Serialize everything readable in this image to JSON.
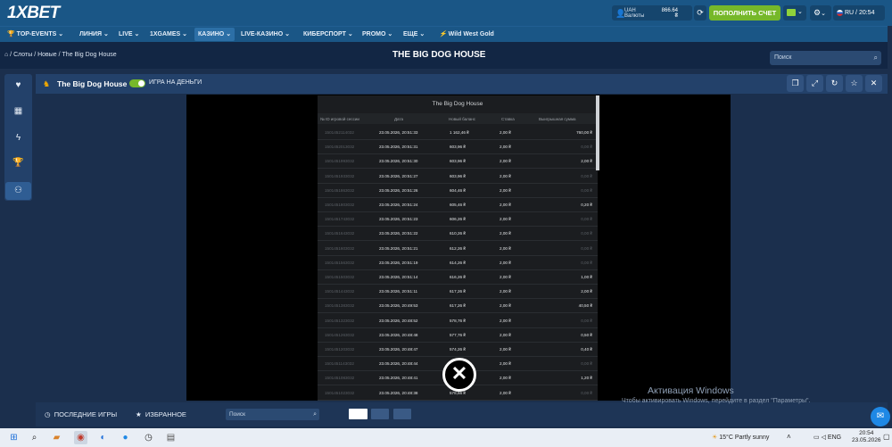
{
  "brand": {
    "logo": "1XBET"
  },
  "account": {
    "currency": "UAH",
    "currency_label": "Валюты",
    "balance": "866.64",
    "balance_sub": "₴"
  },
  "buttons": {
    "deposit": "ПОПОЛНИТЬ СЧЕТ",
    "lang_time": "RU / 20:54"
  },
  "nav": [
    {
      "label": "TOP-EVENTS ⌄"
    },
    {
      "label": "ЛИНИЯ ⌄"
    },
    {
      "label": "LIVE ⌄"
    },
    {
      "label": "1XGAMES ⌄"
    },
    {
      "label": "КАЗИНО ⌄"
    },
    {
      "label": "LIVE-КАЗИНО ⌄"
    },
    {
      "label": "КИБЕРСПОРТ ⌄"
    },
    {
      "label": "PROMO ⌄"
    },
    {
      "label": "ЕЩЕ ⌄"
    },
    {
      "label": "Wild West Gold"
    }
  ],
  "breadcrumb": "Слоты / Новые / The Big Dog House",
  "page_title": "THE BIG DOG HOUSE",
  "search_placeholder": "Поиск",
  "game_header": {
    "title": "The Big Dog House",
    "money_toggle": "ИГРА НА ДЕНЬГИ"
  },
  "history": {
    "title": "The Big Dog House",
    "columns": [
      "№ ID игровой сессии",
      "Дата",
      "Новый баланс",
      "Ставка",
      "Выигрышная сумма"
    ],
    "rows": [
      [
        "1501452114032",
        "23.05.2026, 20:51:33",
        "1 162,46 ₴",
        "2,00 ₴",
        "760,00 ₴"
      ],
      [
        "1501452013032",
        "23.05.2026, 20:51:31",
        "603,96 ₴",
        "2,00 ₴",
        "0,00 ₴"
      ],
      [
        "1501451993032",
        "23.05.2026, 20:51:30",
        "603,96 ₴",
        "2,00 ₴",
        "2,00 ₴"
      ],
      [
        "1501451933032",
        "23.05.2026, 20:51:27",
        "603,96 ₴",
        "2,00 ₴",
        "0,00 ₴"
      ],
      [
        "1501451863032",
        "23.05.2026, 20:51:26",
        "604,46 ₴",
        "2,00 ₴",
        "0,00 ₴"
      ],
      [
        "1501451803032",
        "23.05.2026, 20:51:24",
        "605,46 ₴",
        "2,00 ₴",
        "0,20 ₴"
      ],
      [
        "1501451743032",
        "23.05.2026, 20:51:23",
        "606,26 ₴",
        "2,00 ₴",
        "0,00 ₴"
      ],
      [
        "1501451643032",
        "23.05.2026, 20:51:22",
        "610,26 ₴",
        "2,00 ₴",
        "0,00 ₴"
      ],
      [
        "1501451603032",
        "23.05.2026, 20:51:21",
        "612,26 ₴",
        "2,00 ₴",
        "0,00 ₴"
      ],
      [
        "1501451563032",
        "23.05.2026, 20:51:19",
        "614,26 ₴",
        "2,00 ₴",
        "0,00 ₴"
      ],
      [
        "1501451503032",
        "23.05.2026, 20:51:14",
        "616,26 ₴",
        "2,00 ₴",
        "1,00 ₴"
      ],
      [
        "1501451443032",
        "23.05.2026, 20:51:11",
        "617,26 ₴",
        "2,00 ₴",
        "2,00 ₴"
      ],
      [
        "1501451383032",
        "23.05.2026, 20:49:53",
        "617,26 ₴",
        "2,00 ₴",
        "40,50 ₴"
      ],
      [
        "1501451323032",
        "23.05.2026, 20:48:52",
        "578,76 ₴",
        "2,00 ₴",
        "0,00 ₴"
      ],
      [
        "1501451263032",
        "23.05.2026, 20:48:48",
        "577,76 ₴",
        "2,00 ₴",
        "0,50 ₴"
      ],
      [
        "1501451203032",
        "23.05.2026, 20:48:47",
        "574,26 ₴",
        "2,00 ₴",
        "0,40 ₴"
      ],
      [
        "1501451143032",
        "23.05.2026, 20:48:44",
        "575,86 ₴",
        "2,00 ₴",
        "0,00 ₴"
      ],
      [
        "1501451083032",
        "23.05.2026, 20:48:41",
        "577,86 ₴",
        "2,00 ₴",
        "1,20 ₴"
      ],
      [
        "1501451023032",
        "23.05.2026, 20:48:38",
        "578,66 ₴",
        "2,00 ₴",
        "0,00 ₴"
      ]
    ]
  },
  "bottom": {
    "recent": "ПОСЛЕДНИЕ ИГРЫ",
    "favorites": "ИЗБРАННОЕ",
    "search_placeholder": "Поиск"
  },
  "windows": {
    "activate_title": "Активация Windows",
    "activate_text": "Чтобы активировать Windows, перейдите в раздел \"Параметры\"."
  },
  "taskbar": {
    "weather": "15°C  Partly sunny",
    "lang": "ENG",
    "time": "20:54",
    "date": "23.05.2026"
  },
  "colors": {
    "accent_green": "#76b82a",
    "header_blue": "#1a5686",
    "page_bg": "#1b2f4d"
  }
}
